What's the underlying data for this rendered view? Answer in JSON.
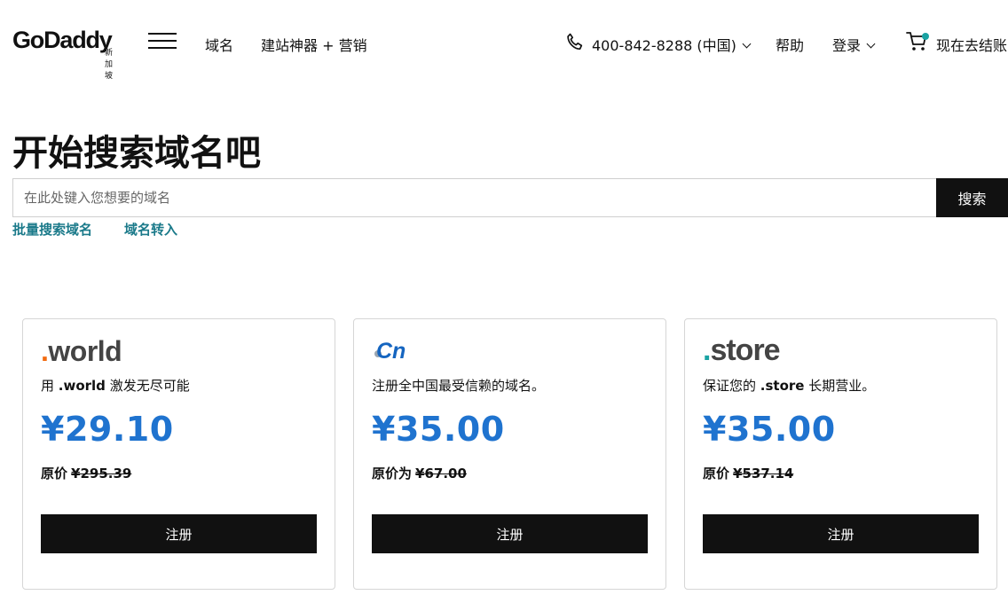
{
  "header": {
    "logo_text": "GoDaddy",
    "logo_region": "新加坡",
    "nav": {
      "domains": "域名",
      "website_marketing": "建站神器 + 营销",
      "phone": "400-842-8288 (中国)",
      "help": "帮助",
      "login": "登录",
      "checkout": "现在去结账"
    }
  },
  "search": {
    "title": "开始搜索域名吧",
    "placeholder": "在此处键入您想要的域名",
    "button_label": "搜索",
    "bulk_search_link": "批量搜索域名",
    "transfer_link": "域名转入"
  },
  "cards": [
    {
      "tld_prefix": ".",
      "tld_name": "world",
      "desc_pre": "用 ",
      "desc_bold": ".world",
      "desc_post": " 激发无尽可能",
      "price": "¥29.10",
      "old_label": "原价",
      "old_price": "¥295.39",
      "button_label": "注册"
    },
    {
      "tld_name": "Cn",
      "desc_pre": "注册全中国最受信赖的域名。",
      "desc_bold": "",
      "desc_post": "",
      "price": "¥35.00",
      "old_label": "原价为",
      "old_price": "¥67.00",
      "button_label": "注册"
    },
    {
      "tld_prefix": ".",
      "tld_name": "store",
      "desc_pre": "保证您的 ",
      "desc_bold": ".store",
      "desc_post": " 长期营业。",
      "price": "¥35.00",
      "old_label": "原价",
      "old_price": "¥537.14",
      "button_label": "注册"
    }
  ],
  "colors": {
    "price_blue": "#1f73cf",
    "link_teal": "#1b7a8a",
    "button_black": "#111111",
    "world_dot": "#f26a0f",
    "store_dot": "#1aa3a3",
    "cn_blue": "#1565c0",
    "cart_badge": "#1aa3a3"
  },
  "icons": [
    "menu-icon",
    "phone-icon",
    "chevron-down-icon",
    "cart-icon"
  ]
}
